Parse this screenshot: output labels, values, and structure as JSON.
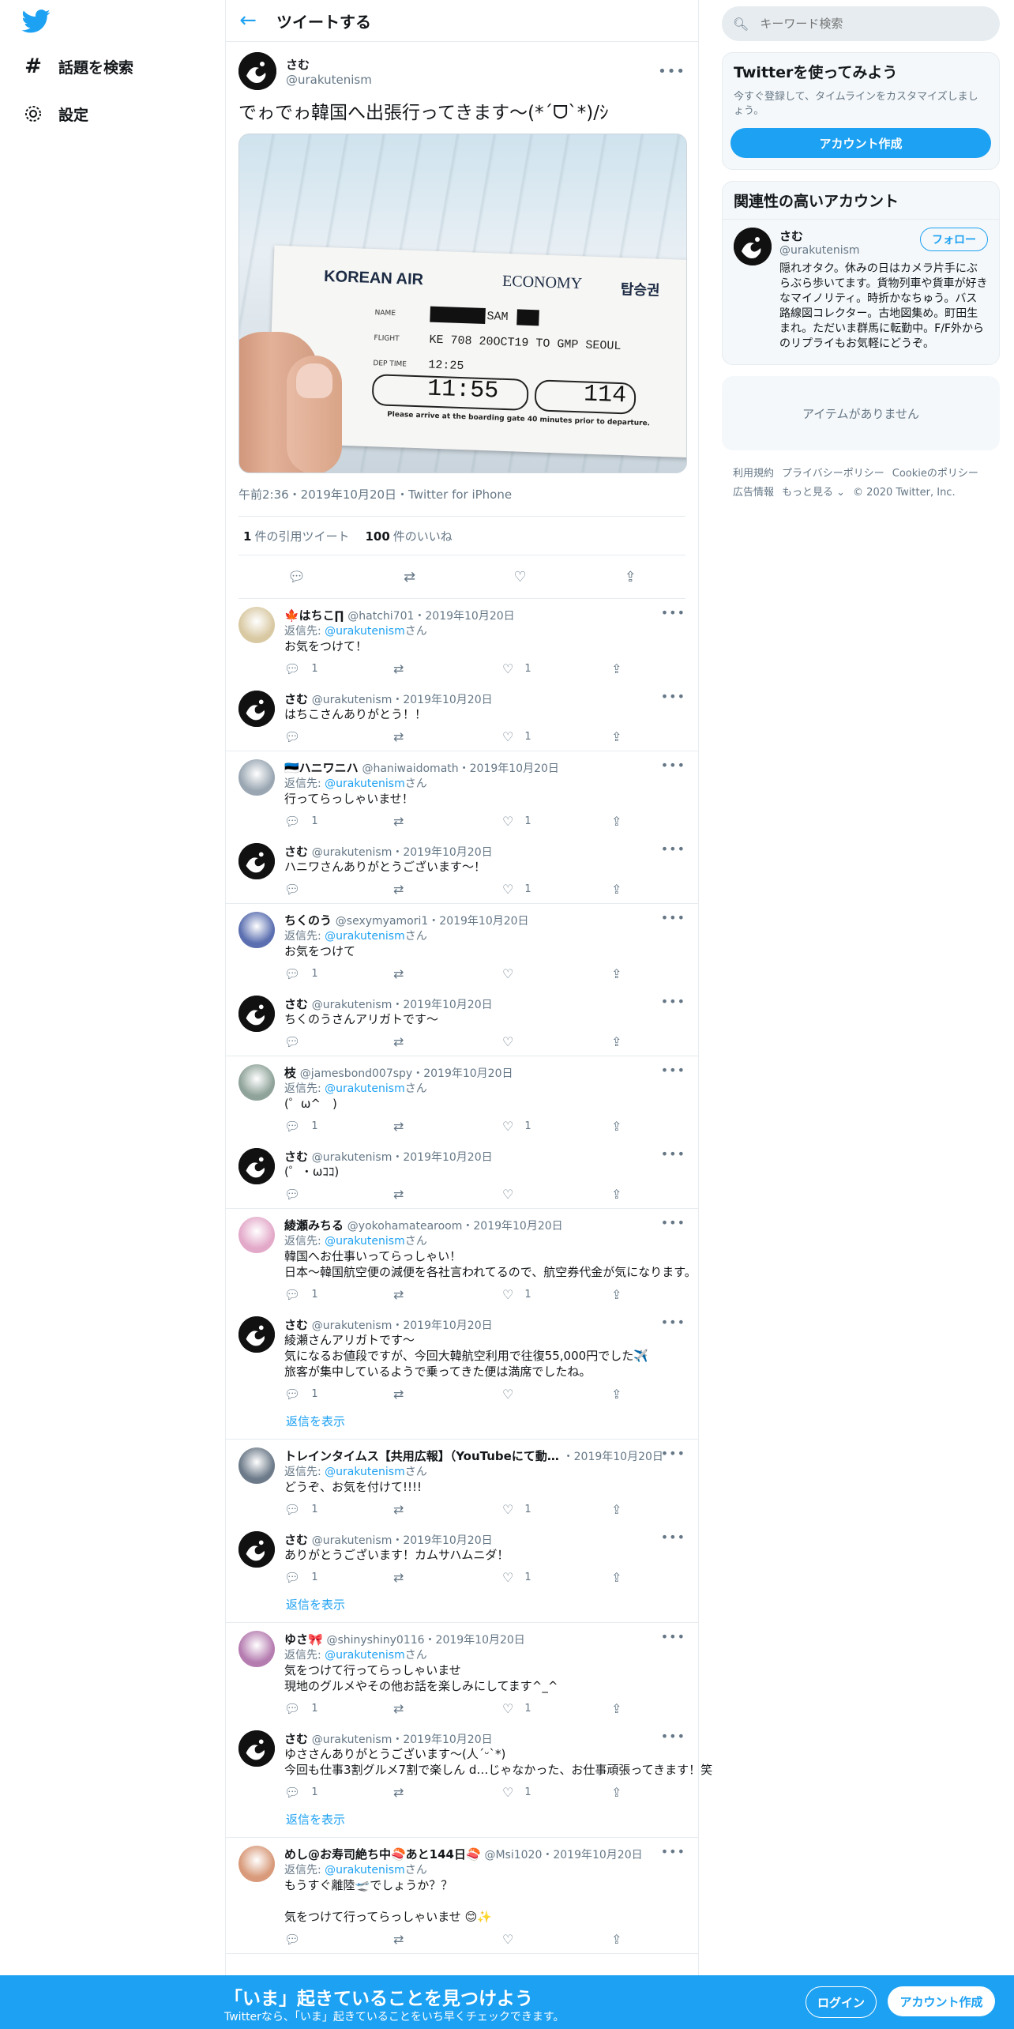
{
  "nav": {
    "explore_label": "話題を検索",
    "settings_label": "設定"
  },
  "header": {
    "title": "ツイートする"
  },
  "main_tweet": {
    "name": "さむ",
    "handle": "@urakutenism",
    "text": "でゎでゎ韓国へ出張行ってきます〜(*ˊᗜˋ*)/ｼ",
    "ticket": {
      "airline": "KOREAN AIR",
      "class": "ECONOMY",
      "korean": "탑승권",
      "name_label": "NAME",
      "name_value": "SAM",
      "flight_label": "FLIGHT",
      "flight_value": "KE 708 20OCT19 TO GMP SEOUL",
      "dep_label": "DEP TIME",
      "dep_value": "12:25",
      "boarding_time": "11:55",
      "gate": "114",
      "notice": "Please arrive at the boarding gate 40 minutes prior to departure."
    },
    "meta": "午前2:36・2019年10月20日・Twitter for iPhone",
    "quote_count": "1",
    "quote_label": "件の引用ツイート",
    "like_count": "100",
    "like_label": "件のいいね"
  },
  "threads": [
    {
      "replies": [
        {
          "name": "🍁はちこ∏",
          "handle": "@hatchi701",
          "date": "・2019年10月20日",
          "replyto_prefix": "返信先: ",
          "replyto_user": "@urakutenism",
          "replyto_suffix": "さん",
          "text": "お気をつけて！",
          "reply_count": "1",
          "rt_count": "",
          "like_count": "1"
        },
        {
          "name": "さむ",
          "handle": "@urakutenism",
          "date": "・2019年10月20日",
          "text": "はちこさんありがとう！！",
          "reply_count": "",
          "rt_count": "",
          "like_count": "1"
        }
      ]
    },
    {
      "replies": [
        {
          "name": "🇪🇪ハニワニハ",
          "handle": "@haniwaidomath",
          "date": "・2019年10月20日",
          "replyto_prefix": "返信先: ",
          "replyto_user": "@urakutenism",
          "replyto_suffix": "さん",
          "text": "行ってらっしゃいませ！",
          "reply_count": "1",
          "rt_count": "",
          "like_count": "1"
        },
        {
          "name": "さむ",
          "handle": "@urakutenism",
          "date": "・2019年10月20日",
          "text": "ハニワさんありがとうございます〜！",
          "reply_count": "",
          "rt_count": "",
          "like_count": "1"
        }
      ]
    },
    {
      "replies": [
        {
          "name": "ちくのう",
          "handle": "@sexymyamori1",
          "date": "・2019年10月20日",
          "replyto_prefix": "返信先: ",
          "replyto_user": "@urakutenism",
          "replyto_suffix": "さん",
          "text": "お気をつけて",
          "reply_count": "1",
          "rt_count": "",
          "like_count": ""
        },
        {
          "name": "さむ",
          "handle": "@urakutenism",
          "date": "・2019年10月20日",
          "text": "ちくのうさんアリガトです〜",
          "reply_count": "",
          "rt_count": "",
          "like_count": ""
        }
      ]
    },
    {
      "replies": [
        {
          "name": "枝",
          "handle": "@jamesbond007spy",
          "date": "・2019年10月20日",
          "replyto_prefix": "返信先: ",
          "replyto_user": "@urakutenism",
          "replyto_suffix": "さん",
          "text": "(゜ω^　)",
          "reply_count": "1",
          "rt_count": "",
          "like_count": "1"
        },
        {
          "name": "さむ",
          "handle": "@urakutenism",
          "date": "・2019年10月20日",
          "text": "(゜・ωｺｺ)",
          "reply_count": "",
          "rt_count": "",
          "like_count": ""
        }
      ]
    },
    {
      "replies": [
        {
          "name": "綾瀬みちる",
          "handle": "@yokohamatearoom",
          "date": "・2019年10月20日",
          "replyto_prefix": "返信先: ",
          "replyto_user": "@urakutenism",
          "replyto_suffix": "さん",
          "text": "韓国へお仕事いってらっしゃい！\n日本～韓国航空便の減便を各社言われてるので、航空券代金が気になります。",
          "reply_count": "1",
          "rt_count": "",
          "like_count": "1"
        },
        {
          "name": "さむ",
          "handle": "@urakutenism",
          "date": "・2019年10月20日",
          "text": "綾瀬さんアリガトです〜\n気になるお値段ですが、今回大韓航空利用で往復55,000円でした✈️\n旅客が集中しているようで乗ってきた便は満席でしたね。",
          "reply_count": "1",
          "rt_count": "",
          "like_count": ""
        }
      ],
      "show_replies": "返信を表示"
    },
    {
      "replies": [
        {
          "name": "トレインタイムス【共用広報】（YouTubeにて動…",
          "handle": "",
          "date": "・2019年10月20日",
          "replyto_prefix": "返信先: ",
          "replyto_user": "@urakutenism",
          "replyto_suffix": "さん",
          "text": "どうぞ、お気を付けて!!!!",
          "reply_count": "1",
          "rt_count": "",
          "like_count": "1"
        },
        {
          "name": "さむ",
          "handle": "@urakutenism",
          "date": "・2019年10月20日",
          "text": "ありがとうございます！カムサハムニダ！",
          "reply_count": "1",
          "rt_count": "",
          "like_count": "1"
        }
      ],
      "show_replies": "返信を表示"
    },
    {
      "replies": [
        {
          "name": "ゆさ🎀",
          "handle": "@shinyshiny0116",
          "date": "・2019年10月20日",
          "replyto_prefix": "返信先: ",
          "replyto_user": "@urakutenism",
          "replyto_suffix": "さん",
          "text": "気をつけて行ってらっしゃいませ\n現地のグルメやその他お話を楽しみにしてます^_^",
          "reply_count": "1",
          "rt_count": "",
          "like_count": "1"
        },
        {
          "name": "さむ",
          "handle": "@urakutenism",
          "date": "・2019年10月20日",
          "text": "ゆささんありがとうございます〜(人ˊᵕˋ*)\n今回も仕事3割グルメ7割で楽しん d…じゃなかった、お仕事頑張ってきます！笑",
          "reply_count": "1",
          "rt_count": "",
          "like_count": "1"
        }
      ],
      "show_replies": "返信を表示"
    },
    {
      "replies": [
        {
          "name": "めし@お寿司絶ち中🍣あと144日🍣",
          "handle": "@Msi1020",
          "date": "・2019年10月20日",
          "replyto_prefix": "返信先: ",
          "replyto_user": "@urakutenism",
          "replyto_suffix": "さん",
          "text": "もうすぐ離陸🛫でしょうか？？\n\n気をつけて行ってらっしゃいませ 😊✨",
          "reply_count": "",
          "rt_count": "",
          "like_count": ""
        }
      ]
    }
  ],
  "right": {
    "search_placeholder": "キーワード検索",
    "signup_card": {
      "title": "Twitterを使ってみよう",
      "subtitle": "今すぐ登録して、タイムラインをカスタマイズしましょう。",
      "button": "アカウント作成"
    },
    "related": {
      "title": "関連性の高いアカウント",
      "name": "さむ",
      "handle": "@urakutenism",
      "follow": "フォロー",
      "bio": "隠れオタク。休みの日はカメラ片手にぶらぶら歩いてます。貨物列車や貨車が好きなマイノリティ。時折かなちゅう。バス路線図コレクター。古地図集め。町田生まれ。ただいま群馬に転勤中。F/F外からのリプライもお気軽にどうぞ。"
    },
    "empty": "アイテムがありません",
    "footer": [
      "利用規約",
      "プライバシーポリシー",
      "Cookieのポリシー",
      "広告情報",
      "もっと見る ⌄",
      "© 2020 Twitter, Inc."
    ]
  },
  "bottom_bar": {
    "title": "「いま」起きていることを見つけよう",
    "subtitle": "Twitterなら、「いま」起きていることをいち早くチェックできます。",
    "login": "ログイン",
    "signup": "アカウント作成"
  },
  "colors": {
    "accent": "#1da1f2",
    "text": "#14171a",
    "muted": "#657786",
    "border": "#e6ecf0"
  },
  "icons": [
    "twitter-bird-icon",
    "hashtag-icon",
    "gear-icon",
    "back-arrow-icon",
    "search-icon",
    "reply-icon",
    "retweet-icon",
    "like-icon",
    "share-icon",
    "more-icon"
  ]
}
